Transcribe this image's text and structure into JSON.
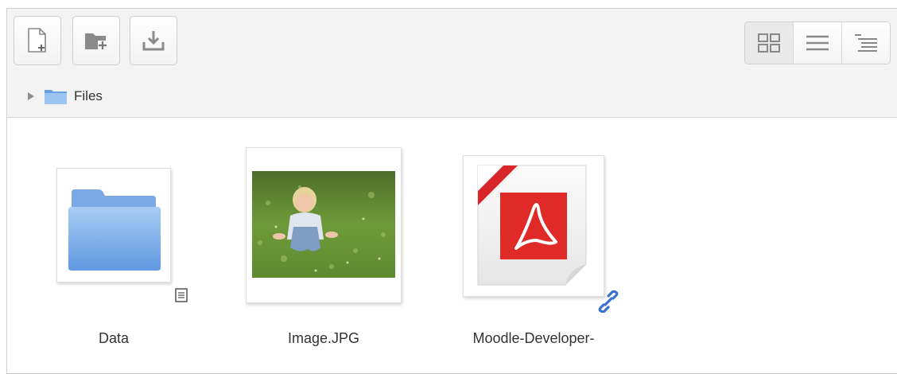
{
  "toolbar": {
    "buttons": [
      {
        "icon": "new-file-icon"
      },
      {
        "icon": "new-folder-icon"
      },
      {
        "icon": "download-icon"
      }
    ],
    "view_modes": [
      {
        "icon": "grid-view-icon",
        "selected": true
      },
      {
        "icon": "list-view-icon",
        "selected": false
      },
      {
        "icon": "tree-view-icon",
        "selected": false
      }
    ]
  },
  "path": {
    "label": "Files"
  },
  "files": [
    {
      "name": "Data",
      "type": "folder"
    },
    {
      "name": "Image.JPG",
      "type": "image"
    },
    {
      "name": "Moodle-Developer-",
      "type": "pdf"
    }
  ],
  "colors": {
    "folder_blue": "#7fb1ea",
    "pdf_red": "#e02a27",
    "link_blue": "#3b6fd1"
  }
}
